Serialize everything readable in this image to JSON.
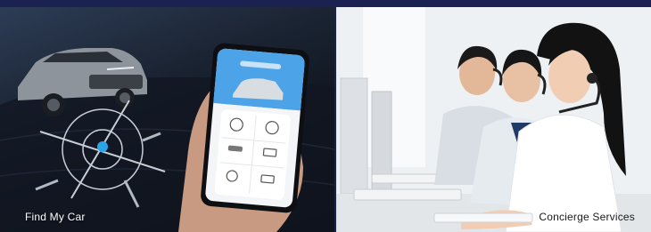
{
  "panels": {
    "left": {
      "caption": "Find My Car"
    },
    "right": {
      "caption": "Concierge Services"
    }
  },
  "colors": {
    "border": "#1b2150",
    "locator_dot": "#2aa6e8",
    "app_header": "#4da3e8"
  }
}
